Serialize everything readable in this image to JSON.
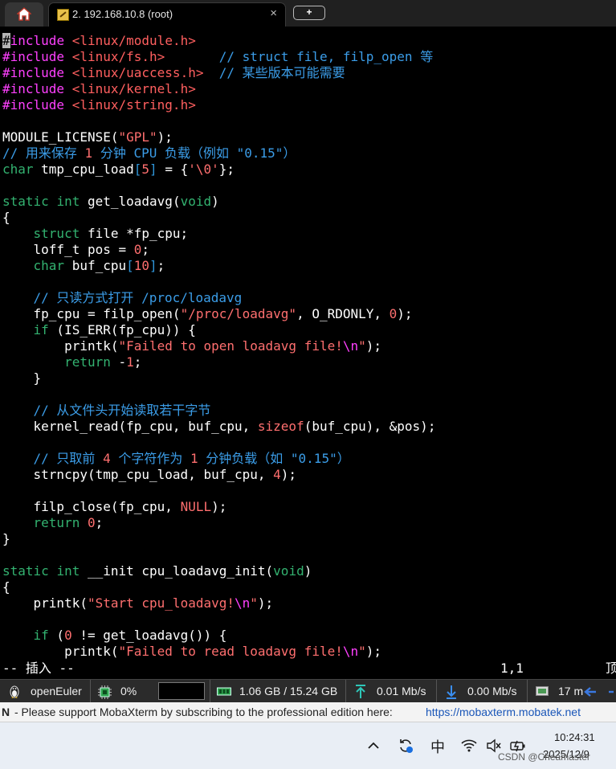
{
  "tabs": {
    "home_icon": "home-icon",
    "active_tab_label": "2. 192.168.10.8 (root)",
    "close_glyph": "×",
    "new_tab_glyph": "+"
  },
  "editor": {
    "lines": [
      [
        {
          "t": "#",
          "c": "cursor"
        },
        {
          "t": "include",
          "c": "k-pp"
        },
        {
          "t": " "
        },
        {
          "t": "<linux/module.h>",
          "c": "k-inc"
        }
      ],
      [
        {
          "t": "#include",
          "c": "k-pp"
        },
        {
          "t": " "
        },
        {
          "t": "<linux/fs.h>",
          "c": "k-inc"
        },
        {
          "t": "       "
        },
        {
          "t": "// struct file, filp_open 等",
          "c": "k-cm"
        }
      ],
      [
        {
          "t": "#include",
          "c": "k-pp"
        },
        {
          "t": " "
        },
        {
          "t": "<linux/uaccess.h>",
          "c": "k-inc"
        },
        {
          "t": "  "
        },
        {
          "t": "// 某些版本可能需要",
          "c": "k-cm"
        }
      ],
      [
        {
          "t": "#include",
          "c": "k-pp"
        },
        {
          "t": " "
        },
        {
          "t": "<linux/kernel.h>",
          "c": "k-inc"
        }
      ],
      [
        {
          "t": "#include",
          "c": "k-pp"
        },
        {
          "t": " "
        },
        {
          "t": "<linux/string.h>",
          "c": "k-inc"
        }
      ],
      [],
      [
        {
          "t": "MODULE_LICENSE("
        },
        {
          "t": "\"GPL\"",
          "c": "k-st"
        },
        {
          "t": ");"
        }
      ],
      [
        {
          "t": "// 用来保存 ",
          "c": "k-cm"
        },
        {
          "t": "1",
          "c": "k-nu"
        },
        {
          "t": " 分钟 CPU 负载（例如 \"0.15\"）",
          "c": "k-cm"
        }
      ],
      [
        {
          "t": "char",
          "c": "k-ty"
        },
        {
          "t": " tmp_cpu_load"
        },
        {
          "t": "[",
          "c": "k-ar"
        },
        {
          "t": "5",
          "c": "k-nu"
        },
        {
          "t": "]",
          "c": "k-ar"
        },
        {
          "t": " = {"
        },
        {
          "t": "'\\0'",
          "c": "k-st"
        },
        {
          "t": "};"
        }
      ],
      [],
      [
        {
          "t": "static",
          "c": "k-ty"
        },
        {
          "t": " "
        },
        {
          "t": "int",
          "c": "k-ty"
        },
        {
          "t": " get_loadavg("
        },
        {
          "t": "void",
          "c": "k-ty"
        },
        {
          "t": ")"
        }
      ],
      [
        {
          "t": "{"
        }
      ],
      [
        {
          "t": "    "
        },
        {
          "t": "struct",
          "c": "k-ty"
        },
        {
          "t": " file *fp_cpu;"
        }
      ],
      [
        {
          "t": "    loff_t pos = "
        },
        {
          "t": "0",
          "c": "k-nu"
        },
        {
          "t": ";"
        }
      ],
      [
        {
          "t": "    "
        },
        {
          "t": "char",
          "c": "k-ty"
        },
        {
          "t": " buf_cpu"
        },
        {
          "t": "[",
          "c": "k-ar"
        },
        {
          "t": "10",
          "c": "k-nu"
        },
        {
          "t": "]",
          "c": "k-ar"
        },
        {
          "t": ";"
        }
      ],
      [],
      [
        {
          "t": "    "
        },
        {
          "t": "// 只读方式打开 /proc/loadavg",
          "c": "k-cm"
        }
      ],
      [
        {
          "t": "    fp_cpu = filp_open("
        },
        {
          "t": "\"/proc/loadavg\"",
          "c": "k-st"
        },
        {
          "t": ", O_RDONLY, "
        },
        {
          "t": "0",
          "c": "k-nu"
        },
        {
          "t": ");"
        }
      ],
      [
        {
          "t": "    "
        },
        {
          "t": "if",
          "c": "k-ty"
        },
        {
          "t": " (IS_ERR(fp_cpu)) {"
        }
      ],
      [
        {
          "t": "        printk("
        },
        {
          "t": "\"Failed to open loadavg file!",
          "c": "k-st"
        },
        {
          "t": "\\n",
          "c": "k-sp"
        },
        {
          "t": "\"",
          "c": "k-st"
        },
        {
          "t": ");"
        }
      ],
      [
        {
          "t": "        "
        },
        {
          "t": "return",
          "c": "k-ty"
        },
        {
          "t": " -"
        },
        {
          "t": "1",
          "c": "k-nu"
        },
        {
          "t": ";"
        }
      ],
      [
        {
          "t": "    }"
        }
      ],
      [],
      [
        {
          "t": "    "
        },
        {
          "t": "// 从文件头开始读取若干字节",
          "c": "k-cm"
        }
      ],
      [
        {
          "t": "    kernel_read(fp_cpu, buf_cpu, "
        },
        {
          "t": "sizeof",
          "c": "k-st"
        },
        {
          "t": "(buf_cpu), &pos);"
        }
      ],
      [],
      [
        {
          "t": "    "
        },
        {
          "t": "// 只取前 ",
          "c": "k-cm"
        },
        {
          "t": "4",
          "c": "k-nu"
        },
        {
          "t": " 个字符作为 ",
          "c": "k-cm"
        },
        {
          "t": "1",
          "c": "k-nu"
        },
        {
          "t": " 分钟负载（如 \"0.15\"）",
          "c": "k-cm"
        }
      ],
      [
        {
          "t": "    strncpy(tmp_cpu_load, buf_cpu, "
        },
        {
          "t": "4",
          "c": "k-nu"
        },
        {
          "t": ");"
        }
      ],
      [],
      [
        {
          "t": "    filp_close(fp_cpu, "
        },
        {
          "t": "NULL",
          "c": "k-nu"
        },
        {
          "t": ");"
        }
      ],
      [
        {
          "t": "    "
        },
        {
          "t": "return",
          "c": "k-ty"
        },
        {
          "t": " "
        },
        {
          "t": "0",
          "c": "k-nu"
        },
        {
          "t": ";"
        }
      ],
      [
        {
          "t": "}"
        }
      ],
      [],
      [
        {
          "t": "static",
          "c": "k-ty"
        },
        {
          "t": " "
        },
        {
          "t": "int",
          "c": "k-ty"
        },
        {
          "t": " __init cpu_loadavg_init("
        },
        {
          "t": "void",
          "c": "k-ty"
        },
        {
          "t": ")"
        }
      ],
      [
        {
          "t": "{"
        }
      ],
      [
        {
          "t": "    printk("
        },
        {
          "t": "\"Start cpu_loadavg!",
          "c": "k-st"
        },
        {
          "t": "\\n",
          "c": "k-sp"
        },
        {
          "t": "\"",
          "c": "k-st"
        },
        {
          "t": ");"
        }
      ],
      [],
      [
        {
          "t": "    "
        },
        {
          "t": "if",
          "c": "k-ty"
        },
        {
          "t": " ("
        },
        {
          "t": "0",
          "c": "k-nu"
        },
        {
          "t": " != get_loadavg()) {"
        }
      ],
      [
        {
          "t": "        printk("
        },
        {
          "t": "\"Failed to read loadavg file!",
          "c": "k-st"
        },
        {
          "t": "\\n",
          "c": "k-sp"
        },
        {
          "t": "\"",
          "c": "k-st"
        },
        {
          "t": ");"
        }
      ]
    ],
    "mode": "-- 插入 --",
    "position": "1,1",
    "scroll": "顶"
  },
  "statusbar": {
    "os_name": "openEuler",
    "cpu_usage": "0%",
    "memory": "1.06 GB / 15.24 GB",
    "upload": "0.01 Mb/s",
    "download": "0.00 Mb/s",
    "uptime": "17 m"
  },
  "ad": {
    "prefix": "N",
    "text": " -  Please support MobaXterm by subscribing to the professional edition here:",
    "link": "https://mobaxterm.mobatek.net"
  },
  "taskbar": {
    "ime": "中",
    "time": "10:24:31",
    "date": "2025/12/9",
    "watermark": "CSDN @Cheamaster"
  },
  "colors": {
    "preprocessor": "#ff40ff",
    "include_path": "#ff5f5f",
    "comment": "#3b9de8",
    "type_keyword": "#33b270",
    "string": "#ff6f6f",
    "terminal_bg": "#000000"
  }
}
